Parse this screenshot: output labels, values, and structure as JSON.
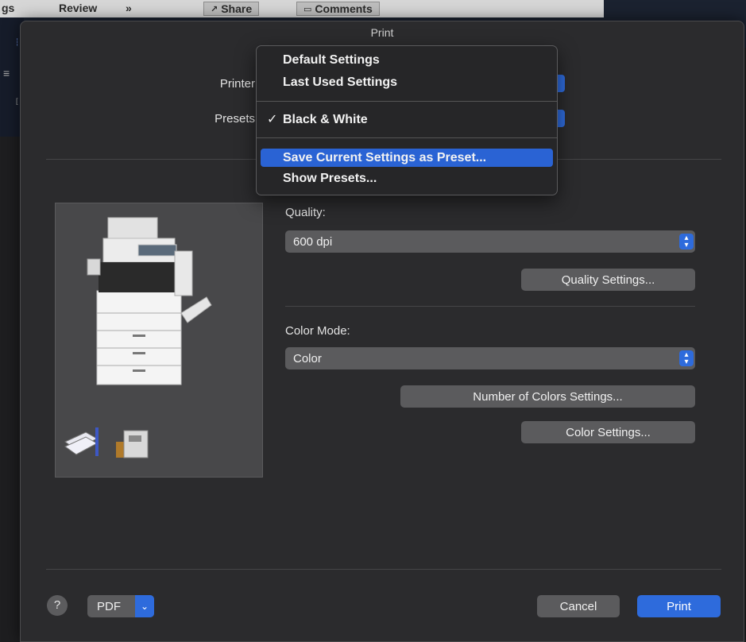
{
  "background": {
    "toolbar_items": [
      "gs",
      "Review",
      "»",
      "Share",
      "Comments"
    ]
  },
  "dialog": {
    "title": "Print",
    "printer_label": "Printer",
    "presets_label": "Presets",
    "quality_label": "Quality:",
    "quality_value": "600 dpi",
    "quality_settings_button": "Quality Settings...",
    "color_mode_label": "Color Mode:",
    "color_mode_value": "Color",
    "number_of_colors_button": "Number of Colors Settings...",
    "color_settings_button": "Color Settings...",
    "help_label": "?",
    "pdf_label": "PDF",
    "cancel_label": "Cancel",
    "print_label": "Print"
  },
  "presets_menu": {
    "items": [
      {
        "label": "Default Settings",
        "checked": false
      },
      {
        "label": "Last Used Settings",
        "checked": false
      },
      {
        "label": "Black & White",
        "checked": true
      },
      {
        "label": "Save Current Settings as Preset...",
        "checked": false,
        "highlighted": true
      },
      {
        "label": "Show Presets...",
        "checked": false
      }
    ],
    "check_glyph": "✓"
  },
  "colors": {
    "accent": "#2e6bdc",
    "dialog_bg": "#2b2b2d",
    "control_bg": "#5b5b5d"
  },
  "icons": [
    "printer-image-icon",
    "paper-stack-icon",
    "fax-icon",
    "chevron-down-icon",
    "popup-arrows-icon",
    "help-icon"
  ]
}
